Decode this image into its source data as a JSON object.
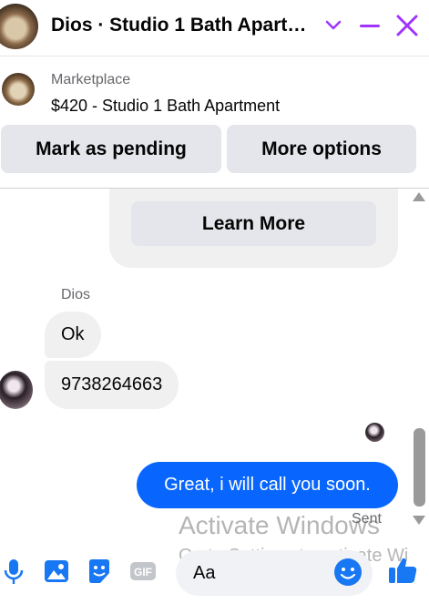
{
  "header": {
    "title": "Dios · Studio 1 Bath Apart…",
    "accent_color": "#a033ff",
    "icons": [
      "chevron-down-icon",
      "minimize-icon",
      "close-icon"
    ]
  },
  "listing": {
    "category": "Marketplace",
    "title": "$420 - Studio 1 Bath Apartment",
    "mark_pending_label": "Mark as pending",
    "more_options_label": "More options"
  },
  "card": {
    "learn_more_label": "Learn More"
  },
  "conversation": {
    "sender_name": "Dios",
    "incoming": [
      "Ok",
      "9738264663"
    ],
    "outgoing": "Great, i will call you soon.",
    "status": "Sent",
    "outgoing_color": "#0866ff"
  },
  "watermark": {
    "title": "Activate Windows",
    "subtitle": "Go to Settings to activate Wi"
  },
  "composer": {
    "placeholder": "Aa",
    "gif_label": "GIF",
    "icons": [
      "microphone-icon",
      "image-icon",
      "sticker-icon",
      "gif-icon",
      "emoji-icon",
      "like-icon"
    ]
  }
}
